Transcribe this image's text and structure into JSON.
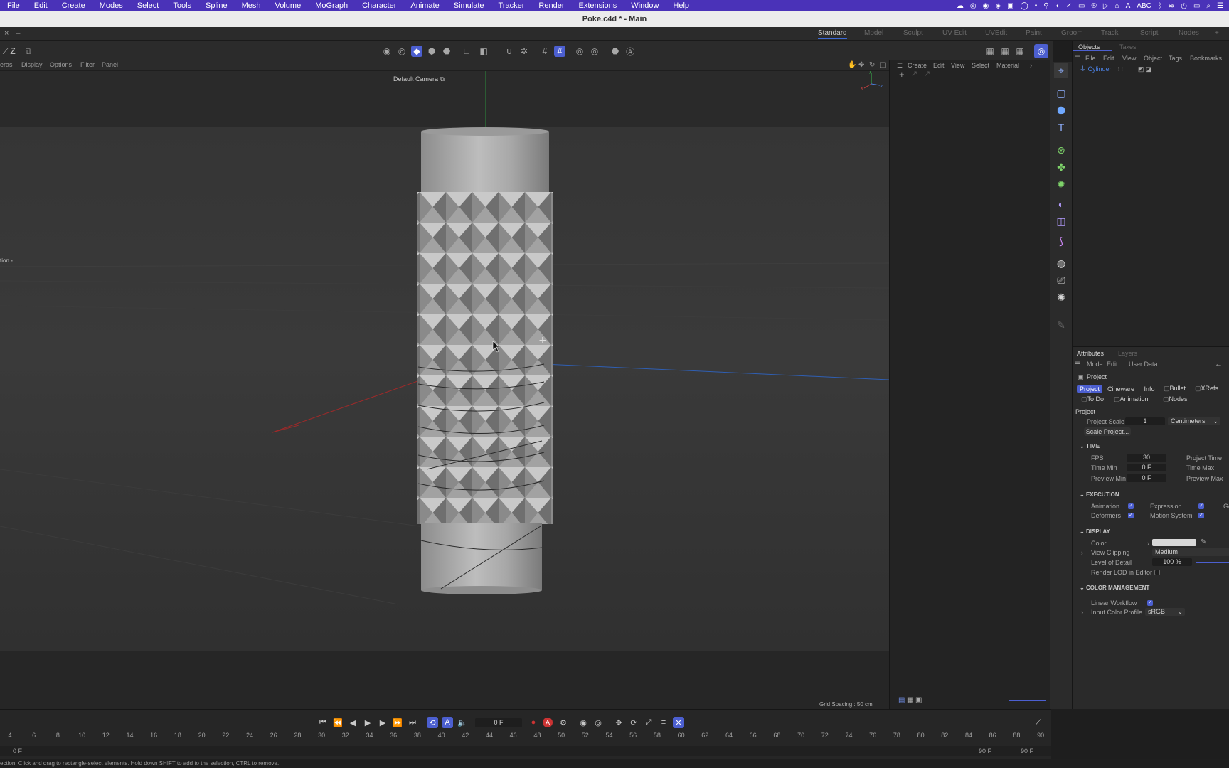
{
  "menubar": {
    "items": [
      "File",
      "Edit",
      "Create",
      "Modes",
      "Select",
      "Tools",
      "Spline",
      "Mesh",
      "Volume",
      "MoGraph",
      "Character",
      "Animate",
      "Simulate",
      "Tracker",
      "Render",
      "Extensions",
      "Window",
      "Help"
    ],
    "keyboard_label": "ABC"
  },
  "window_title": "Poke.c4d * - Main",
  "layout_tabs": [
    "Standard",
    "Model",
    "Sculpt",
    "UV Edit",
    "UVEdit",
    "Paint",
    "Groom",
    "Track",
    "Script",
    "Nodes"
  ],
  "viewport": {
    "menu": [
      "eras",
      "Display",
      "Options",
      "Filter",
      "Panel"
    ],
    "camera_label": "Default Camera",
    "grid_spacing": "Grid Spacing : 50 cm",
    "left_label": "tion"
  },
  "material_manager": {
    "menu": [
      "Create",
      "Edit",
      "View",
      "Select",
      "Material"
    ]
  },
  "objects_panel": {
    "tabs": [
      "Objects",
      "Takes"
    ],
    "menu": [
      "File",
      "Edit",
      "View",
      "Object",
      "Tags",
      "Bookmarks"
    ],
    "objects": [
      {
        "name": "Cylinder"
      }
    ]
  },
  "attributes_panel": {
    "tabs": [
      "Attributes",
      "Layers"
    ],
    "menu": [
      "Mode",
      "Edit",
      "User Data"
    ],
    "header": "Project",
    "sub_tabs_row1": [
      "Project",
      "Cineware",
      "Info",
      "Bullet",
      "XRefs"
    ],
    "sub_tabs_row2": [
      "To Do",
      "Animation",
      "Nodes"
    ],
    "section_title": "Project",
    "project_scale_label": "Project Scale",
    "project_scale_value": "1",
    "project_scale_unit": "Centimeters",
    "scale_button": "Scale Project...",
    "time": {
      "title": "TIME",
      "fps_label": "FPS",
      "fps_value": "30",
      "project_time_label": "Project Time",
      "time_min_label": "Time Min",
      "time_min_value": "0 F",
      "time_max_label": "Time Max",
      "preview_min_label": "Preview Min",
      "preview_min_value": "0 F",
      "preview_max_label": "Preview Max"
    },
    "execution": {
      "title": "EXECUTION",
      "animation_label": "Animation",
      "expression_label": "Expression",
      "deformers_label": "Deformers",
      "motion_system_label": "Motion System",
      "extra_label": "Ge"
    },
    "display": {
      "title": "DISPLAY",
      "color_label": "Color",
      "view_clipping_label": "View Clipping",
      "view_clipping_value": "Medium",
      "lod_label": "Level of Detail",
      "lod_value": "100 %",
      "render_lod_label": "Render LOD in Editor"
    },
    "color_management": {
      "title": "COLOR MANAGEMENT",
      "linear_workflow_label": "Linear Workflow",
      "input_profile_label": "Input Color Profile",
      "input_profile_value": "sRGB"
    }
  },
  "timeline": {
    "current_frame": "0 F",
    "ticks": [
      "4",
      "6",
      "8",
      "10",
      "12",
      "14",
      "16",
      "18",
      "20",
      "22",
      "24",
      "26",
      "28",
      "30",
      "32",
      "34",
      "36",
      "38",
      "40",
      "42",
      "44",
      "46",
      "48",
      "50",
      "52",
      "54",
      "56",
      "58",
      "60",
      "62",
      "64",
      "66",
      "68",
      "70",
      "72",
      "74",
      "76",
      "78",
      "80",
      "82",
      "84",
      "86",
      "88",
      "90"
    ],
    "range_start": "0 F",
    "range_end": "90 F",
    "range_end2": "90 F"
  },
  "status_text": "ection: Click and drag to rectangle-select elements. Hold down SHIFT to add to the selection, CTRL to remove.",
  "colors": {
    "accent": "#4c5fd0",
    "menubar": "#4a32b8",
    "selected_object": "#4a7fe0"
  }
}
